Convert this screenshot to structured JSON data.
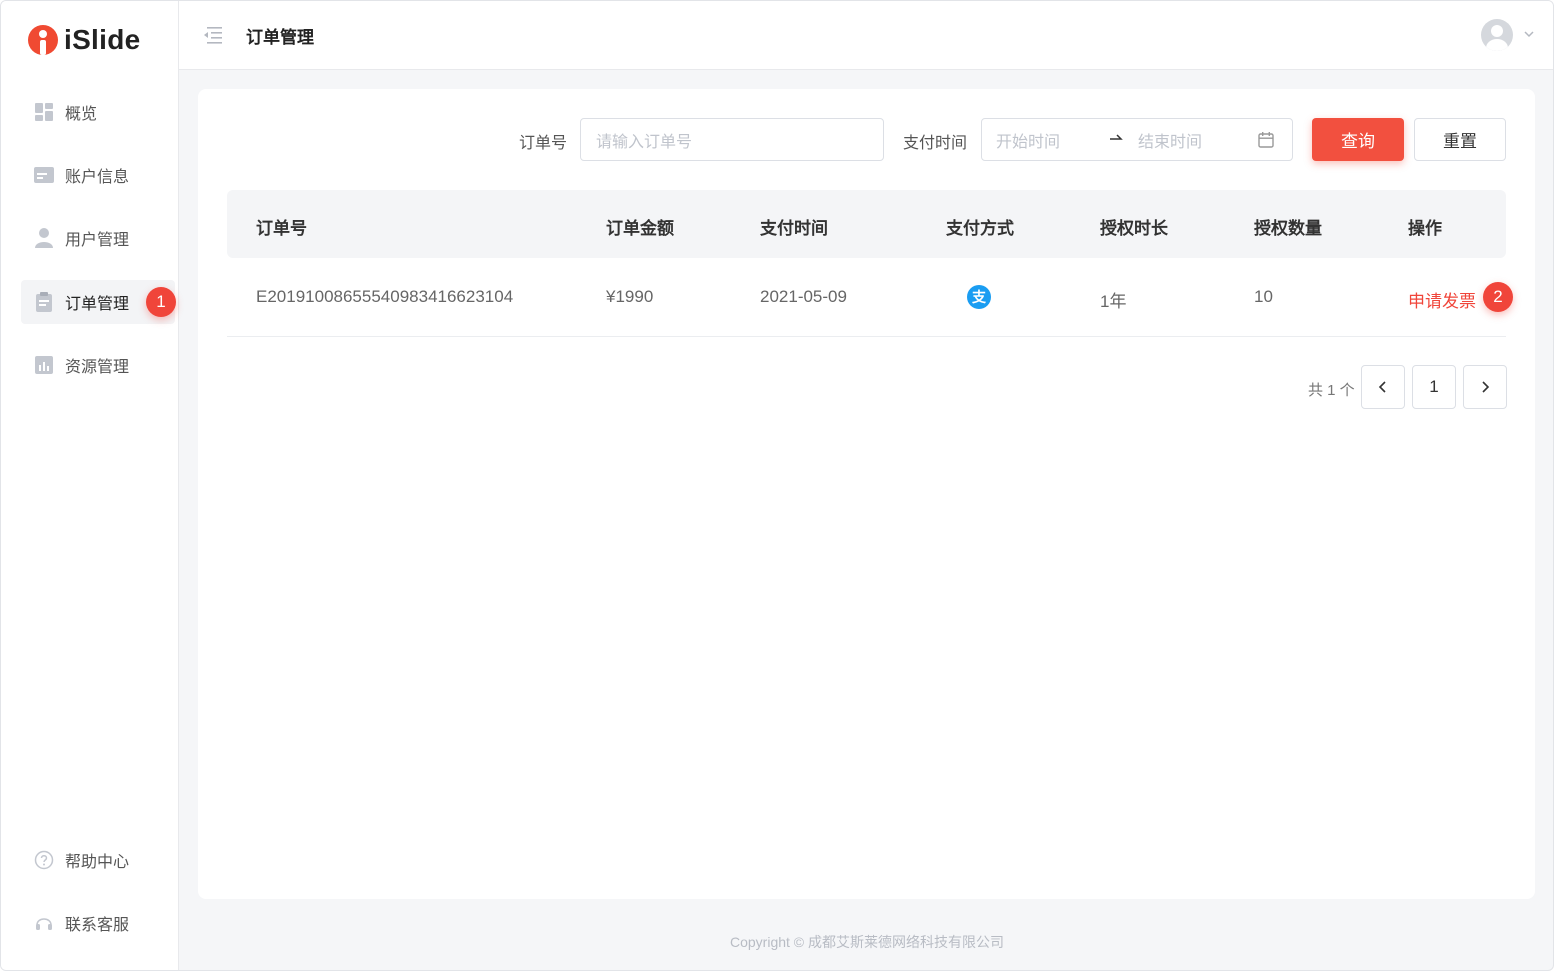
{
  "brand": {
    "name": "iSlide"
  },
  "sidebar": {
    "items": [
      {
        "label": "概览",
        "icon": "dashboard-icon"
      },
      {
        "label": "账户信息",
        "icon": "id-card-icon"
      },
      {
        "label": "用户管理",
        "icon": "user-icon"
      },
      {
        "label": "订单管理",
        "icon": "clipboard-icon",
        "active": true,
        "badge": "1"
      },
      {
        "label": "资源管理",
        "icon": "bar-chart-icon"
      }
    ],
    "bottom": [
      {
        "label": "帮助中心",
        "icon": "help-icon"
      },
      {
        "label": "联系客服",
        "icon": "headset-icon"
      }
    ]
  },
  "header": {
    "title": "订单管理"
  },
  "filters": {
    "order_label": "订单号",
    "order_placeholder": "请输入订单号",
    "time_label": "支付时间",
    "start_placeholder": "开始时间",
    "end_placeholder": "结束时间",
    "query_label": "查询",
    "reset_label": "重置"
  },
  "table": {
    "columns": [
      "订单号",
      "订单金额",
      "支付时间",
      "支付方式",
      "授权时长",
      "授权数量",
      "操作"
    ],
    "rows": [
      {
        "order_no": "E20191008655540983416623104",
        "amount": "¥1990",
        "paid_at": "2021-05-09",
        "pay_method_icon": "alipay-icon",
        "duration": "1年",
        "quantity": "10",
        "action": "申请发票",
        "badge": "2"
      }
    ]
  },
  "pagination": {
    "total_text": "共 1 个",
    "current_page": "1"
  },
  "footer": {
    "copyright": "Copyright © 成都艾斯莱德网络科技有限公司"
  },
  "colors": {
    "accent": "#f2503f",
    "badge": "#f0453a",
    "alipay": "#1a9df2"
  }
}
